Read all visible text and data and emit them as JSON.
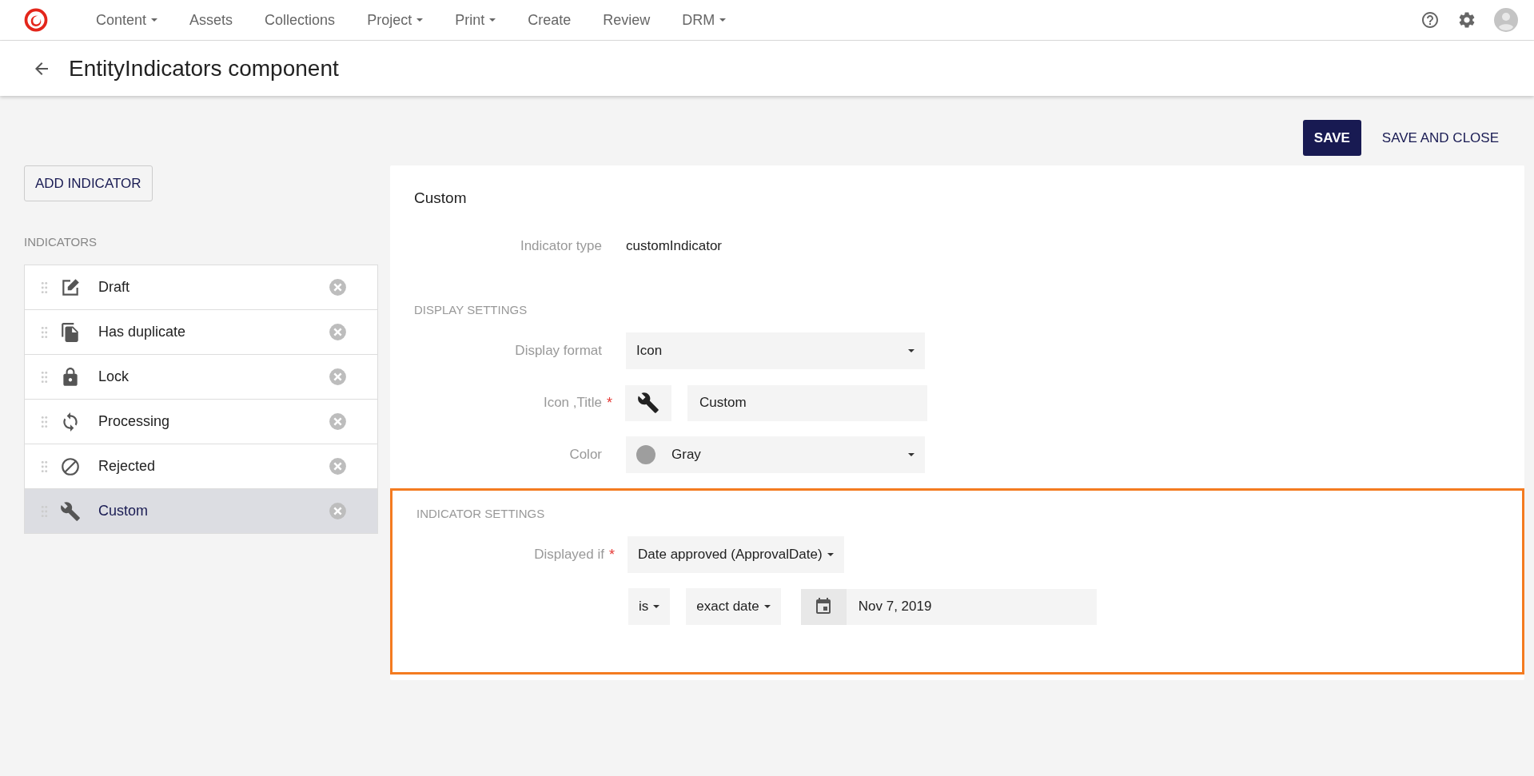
{
  "nav": {
    "items": [
      {
        "label": "Content",
        "dropdown": true
      },
      {
        "label": "Assets",
        "dropdown": false
      },
      {
        "label": "Collections",
        "dropdown": false
      },
      {
        "label": "Project",
        "dropdown": true
      },
      {
        "label": "Print",
        "dropdown": true
      },
      {
        "label": "Create",
        "dropdown": false
      },
      {
        "label": "Review",
        "dropdown": false
      },
      {
        "label": "DRM",
        "dropdown": true
      }
    ]
  },
  "page": {
    "title": "EntityIndicators component"
  },
  "actions": [
    {
      "label": "SAVE",
      "kind": "primary"
    },
    {
      "label": "SAVE AND CLOSE",
      "kind": "flat"
    }
  ],
  "sidebar": {
    "add_button": "ADD INDICATOR",
    "heading": "INDICATORS",
    "items": [
      {
        "label": "Draft",
        "kind": "edit",
        "selected": false
      },
      {
        "label": "Has duplicate",
        "kind": "copy",
        "selected": false
      },
      {
        "label": "Lock",
        "kind": "lock",
        "selected": false
      },
      {
        "label": "Processing",
        "kind": "sync",
        "selected": false
      },
      {
        "label": "Rejected",
        "kind": "block",
        "selected": false
      },
      {
        "label": "Custom",
        "kind": "wrench",
        "selected": true
      }
    ]
  },
  "detail": {
    "title": "Custom",
    "indicator_type": {
      "label": "Indicator type",
      "value": "customIndicator"
    },
    "display_settings": {
      "heading": "DISPLAY SETTINGS",
      "display_format": {
        "label": "Display format",
        "value": "Icon"
      },
      "icon_title": {
        "label": "Icon ,Title",
        "required_mark": "*",
        "value": "Custom"
      },
      "color": {
        "label": "Color",
        "value": "Gray",
        "color": "#9e9e9e"
      }
    },
    "indicator_settings": {
      "heading": "INDICATOR SETTINGS",
      "highlighted": true,
      "displayed_if": {
        "label": "Displayed if",
        "required_mark": "*",
        "field": "Date approved (ApprovalDate)",
        "operator": "is",
        "mode": "exact date",
        "date": "Nov 7, 2019"
      }
    }
  }
}
